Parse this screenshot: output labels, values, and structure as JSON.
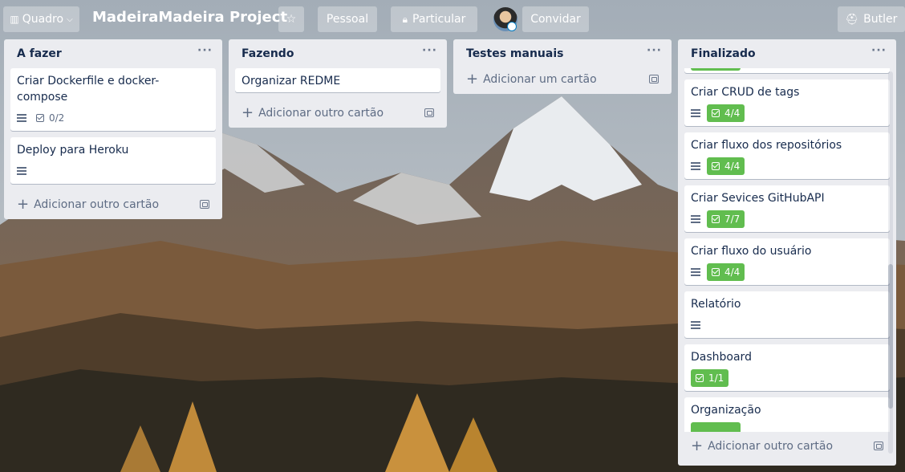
{
  "header": {
    "board_button_label": "Quadro",
    "board_title": "MadeiraMadeira Project",
    "visibility_pessoal": "Pessoal",
    "visibility_particular": "Particular",
    "invite_label": "Convidar",
    "butler_label": "Butler"
  },
  "lists": [
    {
      "title": "A fazer",
      "menu": "···",
      "cards": [
        {
          "title": "Criar Dockerfile e docker-compose",
          "checklist": "0/2"
        },
        {
          "title": "Deploy para Heroku"
        }
      ],
      "add_label": "Adicionar outro cartão"
    },
    {
      "title": "Fazendo",
      "menu": "···",
      "cards": [
        {
          "title": "Organizar REDME"
        }
      ],
      "add_label": "Adicionar outro cartão"
    },
    {
      "title": "Testes manuais",
      "menu": "···",
      "cards": [],
      "add_label": "Adicionar um cartão"
    },
    {
      "title": "Finalizado",
      "menu": "···",
      "cards": [
        {
          "title": "Criar CRUD de tags",
          "checklist": "4/4"
        },
        {
          "title": "Criar fluxo dos repositórios",
          "checklist": "4/4"
        },
        {
          "title": "Criar Sevices GitHubAPI",
          "checklist": "7/7"
        },
        {
          "title": "Criar fluxo do usuário",
          "checklist": "4/4"
        },
        {
          "title": "Relatório"
        },
        {
          "title": "Dashboard",
          "checklist": "1/1"
        },
        {
          "title": "Organização"
        }
      ],
      "add_label": "Adicionar outro cartão"
    }
  ],
  "colors": {
    "checklist_complete": "#61bd4f",
    "list_background": "#ebecf0",
    "header_button": "rgba(255,255,255,0.3)"
  }
}
